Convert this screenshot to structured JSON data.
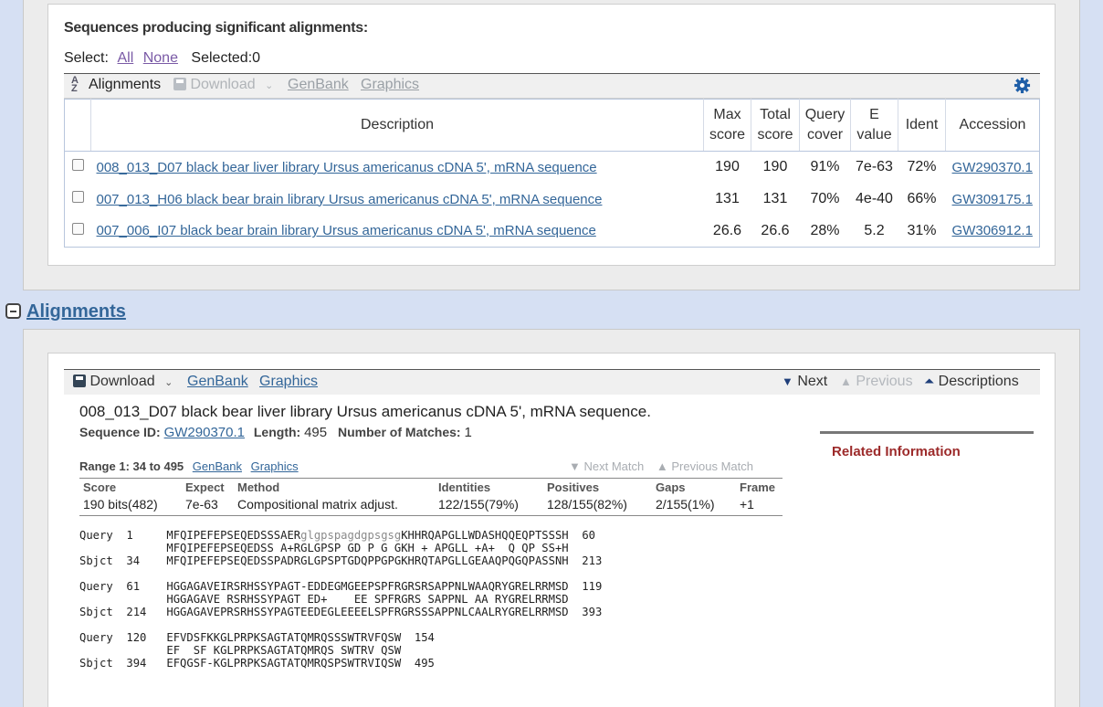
{
  "descriptions": {
    "title": "Sequences producing significant alignments:",
    "select_label": "Select:",
    "select_all": "All",
    "select_none": "None",
    "selected_count": "Selected:0",
    "toolbar": {
      "alignments_label": "Alignments",
      "download_label": "Download",
      "genbank_label": "GenBank",
      "graphics_label": "Graphics"
    },
    "columns": {
      "description": "Description",
      "max_score": [
        "Max",
        "score"
      ],
      "total_score": [
        "Total",
        "score"
      ],
      "query_cover": [
        "Query",
        "cover"
      ],
      "e_value": [
        "E",
        "value"
      ],
      "ident": "Ident",
      "accession": "Accession"
    },
    "rows": [
      {
        "description": "008_013_D07 black bear liver library Ursus americanus cDNA 5', mRNA sequence",
        "max_score": "190",
        "total_score": "190",
        "query_cover": "91%",
        "e_value": "7e-63",
        "ident": "72%",
        "accession": "GW290370.1"
      },
      {
        "description": "007_013_H06 black bear brain library Ursus americanus cDNA 5', mRNA sequence",
        "max_score": "131",
        "total_score": "131",
        "query_cover": "70%",
        "e_value": "4e-40",
        "ident": "66%",
        "accession": "GW309175.1"
      },
      {
        "description": "007_006_I07 black bear brain library Ursus americanus cDNA 5', mRNA sequence",
        "max_score": "26.6",
        "total_score": "26.6",
        "query_cover": "28%",
        "e_value": "5.2",
        "ident": "31%",
        "accession": "GW306912.1"
      }
    ]
  },
  "alignments": {
    "heading": "Alignments",
    "toolbar": {
      "download_label": "Download",
      "genbank_label": "GenBank",
      "graphics_label": "Graphics",
      "next_label": "Next",
      "previous_label": "Previous",
      "descriptions_label": "Descriptions"
    },
    "hit": {
      "title": "008_013_D07 black bear liver library Ursus americanus cDNA 5', mRNA sequence.",
      "sequence_id_label": "Sequence ID:",
      "sequence_id": "GW290370.1",
      "length_label": "Length:",
      "length": "495",
      "matches_label": "Number of Matches:",
      "matches": "1"
    },
    "related_info": "Related Information",
    "range": {
      "label": "Range 1: 34 to 495",
      "genbank_label": "GenBank",
      "graphics_label": "Graphics",
      "next_match": "Next Match",
      "previous_match": "Previous Match"
    },
    "score_table": {
      "headers": [
        "Score",
        "Expect",
        "Method",
        "Identities",
        "Positives",
        "Gaps",
        "Frame"
      ],
      "values": [
        "190 bits(482)",
        "7e-63",
        "Compositional matrix adjust.",
        "122/155(79%)",
        "128/155(82%)",
        "2/155(1%)",
        "+1"
      ]
    },
    "sequence_blocks": [
      {
        "query_prefix": "Query  1     ",
        "query_seq_a": "MFQIPEFEPSEQEDSSSAER",
        "query_seq_lc": "glgpspagdgpsgsg",
        "query_seq_b": "KHHRQAPGLLWDASHQQEQPTSSSH  60",
        "match": "             MFQIPEFEPSEQEDSS A+RGLGPSP GD P G GKH + APGLL +A+  Q QP SS+H",
        "sbjct": "Sbjct  34    MFQIPEFEPSEQEDSSPADRGLGPSPTGDQPPGPGKHRQTAPGLLGEAAQPQGQPASSNH  213"
      },
      {
        "query": "Query  61    HGGAGAVEIRSRHSSYPAGT-EDDEGMGEEPSPFRGRSRSAPPNLWAAQRYGRELRRMSD  119",
        "match": "             HGGAGAVE RSRHSSYPAGT ED+    EE SPFRGRS SAPPNL AA RYGRELRRMSD",
        "sbjct": "Sbjct  214   HGGAGAVEPRSRHSSYPAGTEEDEGLEEEELSPFRGRSSSAPPNLCAALRYGRELRRMSD  393"
      },
      {
        "query": "Query  120   EFVDSFKKGLPRPKSAGTATQMRQSSSWTRVFQSW  154",
        "match": "             EF  SF KGLPRPKSAGTATQMRQS SWTRV QSW",
        "sbjct": "Sbjct  394   EFQGSF-KGLPRPKSAGTATQMRQSPSWTRVIQSW  495"
      }
    ]
  }
}
